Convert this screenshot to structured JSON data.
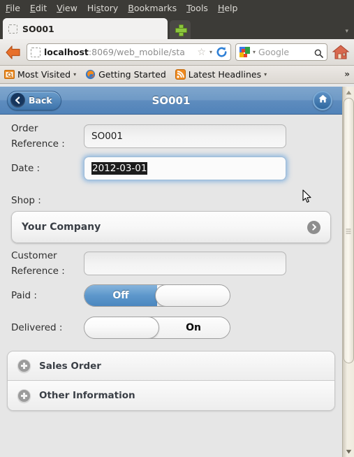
{
  "browser": {
    "menu": [
      {
        "pre": "",
        "acc": "F",
        "post": "ile"
      },
      {
        "pre": "",
        "acc": "E",
        "post": "dit"
      },
      {
        "pre": "",
        "acc": "V",
        "post": "iew"
      },
      {
        "pre": "Hi",
        "acc": "s",
        "post": "tory"
      },
      {
        "pre": "",
        "acc": "B",
        "post": "ookmarks"
      },
      {
        "pre": "",
        "acc": "T",
        "post": "ools"
      },
      {
        "pre": "",
        "acc": "H",
        "post": "elp"
      }
    ],
    "tab": {
      "title": "SO001",
      "new_tab_label": "+",
      "tab_list_arrow": "▾"
    },
    "nav": {
      "back_label": "Back",
      "url_host": "localhost",
      "url_rest": ":8069/web_mobile/sta",
      "bookmark_star": "☆",
      "dropdown_arrow": "▾",
      "reload_label": "Reload",
      "search_engine": "Google",
      "search_placeholder": "Google",
      "home_label": "Home"
    },
    "bookmarks": [
      {
        "label": "Most Visited",
        "icon": "most-visited-icon",
        "arrow": "▾"
      },
      {
        "label": "Getting Started",
        "icon": "firefox-icon",
        "arrow": ""
      },
      {
        "label": "Latest Headlines",
        "icon": "rss-icon",
        "arrow": "▾"
      }
    ],
    "overflow_chevron": "»"
  },
  "app": {
    "header": {
      "back_label": "Back",
      "title": "SO001",
      "home_icon": "home-icon"
    },
    "fields": [
      {
        "key": "order_reference",
        "label": "Order Reference :",
        "value": "SO001",
        "placeholder": "",
        "focused": false
      },
      {
        "key": "date",
        "label": "Date :",
        "value": "2012-03-01",
        "placeholder": "",
        "focused": true,
        "selected": true
      },
      {
        "key": "customer_reference",
        "label": "Customer Reference :",
        "value": "",
        "placeholder": "",
        "focused": false
      }
    ],
    "shop": {
      "label": "Shop :",
      "value": "Your Company",
      "chevron": "❯"
    },
    "toggles": [
      {
        "key": "paid",
        "label": "Paid :",
        "state": "off",
        "on_label": "Off",
        "off_label": ""
      },
      {
        "key": "delivered",
        "label": "Delivered :",
        "state": "on",
        "on_label": "",
        "off_label": "On"
      }
    ],
    "accordion": [
      {
        "key": "sales_order",
        "label": "Sales Order",
        "expand_icon": "plus-circle-icon"
      },
      {
        "key": "other_information",
        "label": "Other Information",
        "expand_icon": "plus-circle-icon"
      }
    ]
  },
  "colors": {
    "header_blue": "#5e8cbe",
    "toggle_blue": "#5d97cb",
    "chrome_dark": "#3c3b37",
    "page_bg": "#e6e6e6"
  }
}
